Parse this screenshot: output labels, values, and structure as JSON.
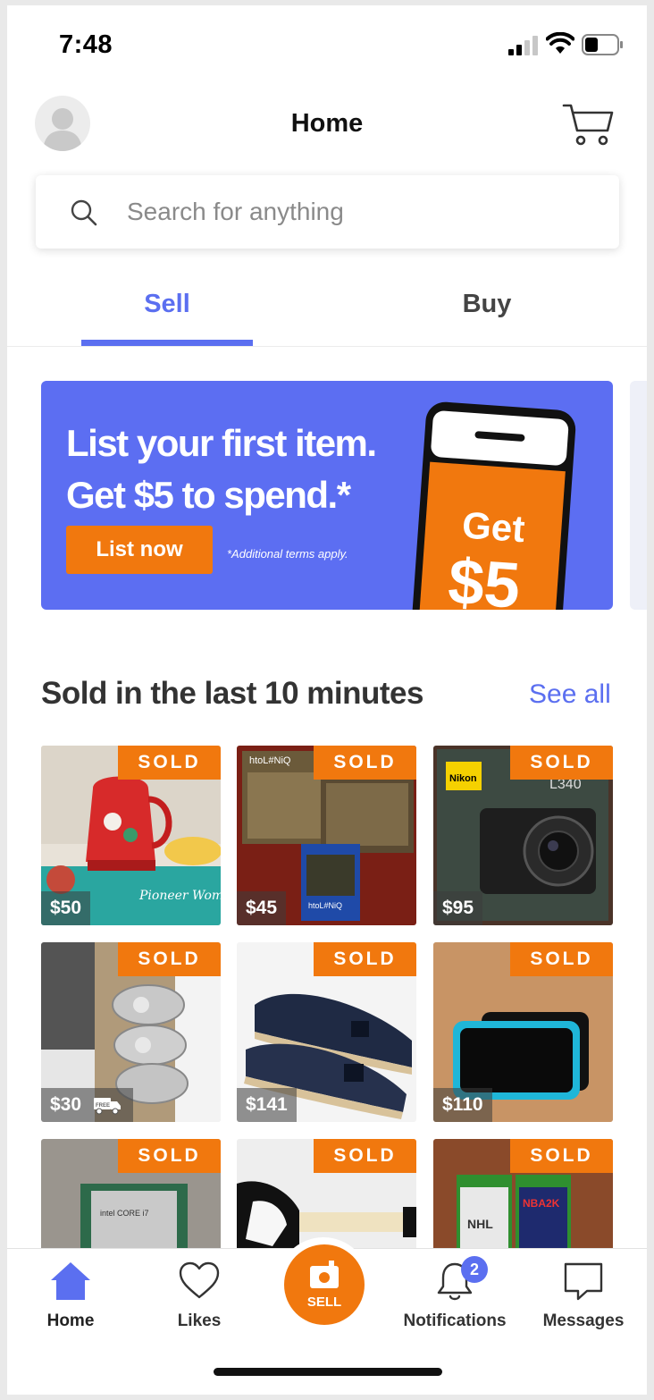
{
  "status_bar": {
    "time": "7:48"
  },
  "header": {
    "title": "Home"
  },
  "search": {
    "placeholder": "Search for anything"
  },
  "tabs": [
    {
      "label": "Sell",
      "active": true
    },
    {
      "label": "Buy",
      "active": false
    }
  ],
  "banner": {
    "line1": "List your first item.",
    "line2": "Get $5 to spend.*",
    "cta": "List now",
    "terms": "*Additional terms apply.",
    "phone_word": "Get",
    "phone_amount": "$5",
    "colors": {
      "background": "#5c6ef2",
      "accent": "#f1780e"
    }
  },
  "sold_section": {
    "title": "Sold in the last 10 minutes",
    "see_all": "See all",
    "items": [
      {
        "tag": "SOLD",
        "price": "$50",
        "subject": "red-floral-kettle"
      },
      {
        "tag": "SOLD",
        "price": "$45",
        "subject": "video-game-case"
      },
      {
        "tag": "SOLD",
        "price": "$95",
        "subject": "nikon-camera-box"
      },
      {
        "tag": "SOLD",
        "price": "$30",
        "subject": "silver-sandals",
        "free_shipping": true
      },
      {
        "tag": "SOLD",
        "price": "$141",
        "subject": "navy-espadrilles"
      },
      {
        "tag": "SOLD",
        "price": "$110",
        "subject": "handheld-console"
      },
      {
        "tag": "SOLD",
        "price": "",
        "subject": "cpu-chip"
      },
      {
        "tag": "SOLD",
        "price": "",
        "subject": "guitar-controller"
      },
      {
        "tag": "SOLD",
        "price": "",
        "subject": "xbox-games"
      }
    ]
  },
  "tab_bar": {
    "home": "Home",
    "likes": "Likes",
    "sell": "SELL",
    "notifications": "Notifications",
    "notifications_badge": "2",
    "messages": "Messages"
  },
  "colors": {
    "accent_blue": "#5b6ff0",
    "sold_orange": "#f1780e"
  }
}
